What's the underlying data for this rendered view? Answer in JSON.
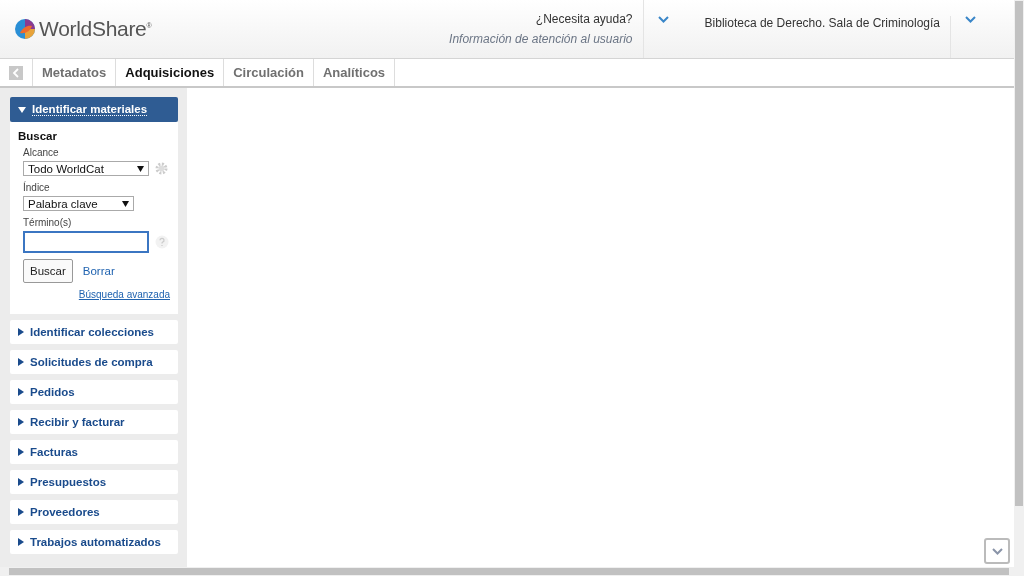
{
  "header": {
    "logo_text": "WorldShare$^{®}$",
    "help": {
      "label": "¿Necesita ayuda?",
      "sublabel": "Información de atención al usuario"
    },
    "institution": "Biblioteca de Derecho. Sala de Criminología"
  },
  "tabs": [
    {
      "label": "Metadatos",
      "selected": false
    },
    {
      "label": "Adquisiciones",
      "selected": true
    },
    {
      "label": "Circulación",
      "selected": false
    },
    {
      "label": "Analíticos",
      "selected": false
    }
  ],
  "sections": [
    {
      "label": "Identificar materiales",
      "expanded": true
    },
    {
      "label": "Identificar colecciones",
      "expanded": false
    },
    {
      "label": "Solicitudes de compra",
      "expanded": false
    },
    {
      "label": "Pedidos",
      "expanded": false
    },
    {
      "label": "Recibir y facturar",
      "expanded": false
    },
    {
      "label": "Facturas",
      "expanded": false
    },
    {
      "label": "Presupuestos",
      "expanded": false
    },
    {
      "label": "Proveedores",
      "expanded": false
    },
    {
      "label": "Trabajos automatizados",
      "expanded": false
    }
  ],
  "search": {
    "heading": "Buscar",
    "scope_label": "Alcance",
    "scope_value": "Todo WorldCat",
    "index_label": "Índice",
    "index_value": "Palabra clave",
    "terms_label": "Término(s)",
    "search_button": "Buscar",
    "clear_link": "Borrar",
    "advanced_link": "Búsqueda avanzada"
  }
}
